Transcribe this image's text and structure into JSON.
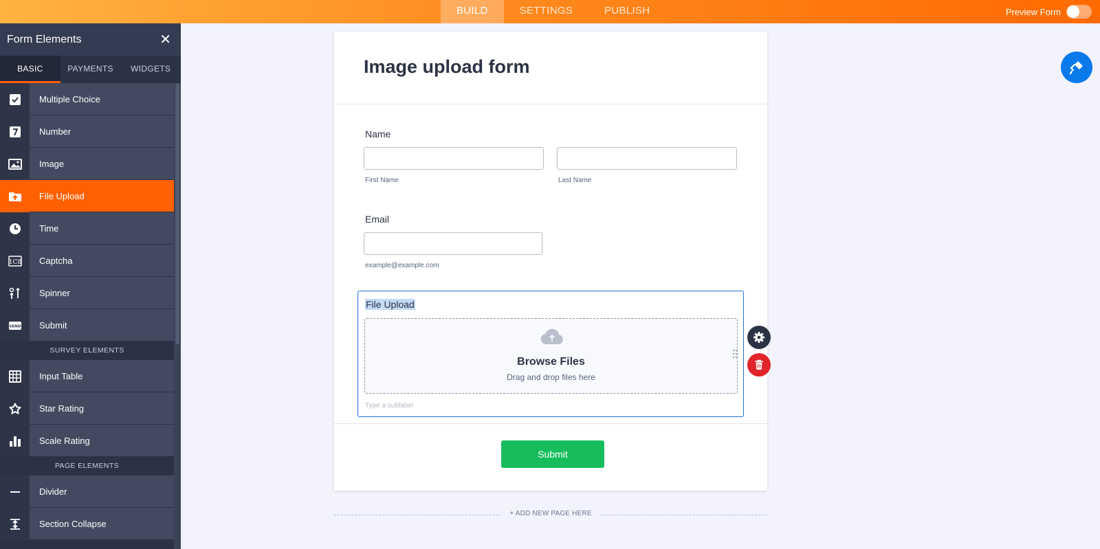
{
  "topbar": {
    "tabs": [
      "BUILD",
      "SETTINGS",
      "PUBLISH"
    ],
    "active_tab": "BUILD",
    "preview_label": "Preview Form",
    "preview_on": false
  },
  "sidebar": {
    "title": "Form Elements",
    "tabs": [
      "BASIC",
      "PAYMENTS",
      "WIDGETS"
    ],
    "items": [
      {
        "label": "Multiple Choice",
        "icon": "checkbox-icon"
      },
      {
        "label": "Number",
        "icon": "number-icon"
      },
      {
        "label": "Image",
        "icon": "image-icon"
      },
      {
        "label": "File Upload",
        "icon": "file-upload-icon"
      },
      {
        "label": "Time",
        "icon": "clock-icon"
      },
      {
        "label": "Captcha",
        "icon": "captcha-icon"
      },
      {
        "label": "Spinner",
        "icon": "spinner-icon"
      },
      {
        "label": "Submit",
        "icon": "send-icon"
      }
    ],
    "survey_heading": "SURVEY ELEMENTS",
    "survey_items": [
      {
        "label": "Input Table",
        "icon": "table-icon"
      },
      {
        "label": "Star Rating",
        "icon": "star-icon"
      },
      {
        "label": "Scale Rating",
        "icon": "bar-chart-icon"
      }
    ],
    "page_heading": "PAGE ELEMENTS",
    "page_items": [
      {
        "label": "Divider",
        "icon": "divider-icon"
      },
      {
        "label": "Section Collapse",
        "icon": "collapse-icon"
      }
    ]
  },
  "form": {
    "title": "Image upload form",
    "name_label": "Name",
    "first_name_sub": "First Name",
    "last_name_sub": "Last Name",
    "email_label": "Email",
    "email_sub": "example@example.com",
    "upload_label": "File Upload",
    "browse_label": "Browse Files",
    "drag_label": "Drag and drop files here",
    "sublabel_placeholder": "Type a sublabel",
    "submit_label": "Submit"
  },
  "add_page_label": "+ ADD NEW PAGE HERE",
  "colors": {
    "accent": "#ff6100",
    "submit": "#18bd5b",
    "selection": "#1f6fe0",
    "delete": "#e0242a",
    "fab": "#0a79ea"
  }
}
